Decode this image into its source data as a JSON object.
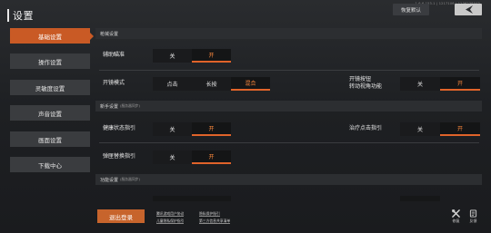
{
  "header": {
    "title": "设置",
    "version": "1.6.6.153.1 | 1217106 | 1236238043",
    "reset_label": "恢复默认"
  },
  "sidebar": {
    "items": [
      {
        "label": "基础设置",
        "active": true
      },
      {
        "label": "操作设置",
        "active": false
      },
      {
        "label": "灵敏度设置",
        "active": false
      },
      {
        "label": "声音设置",
        "active": false
      },
      {
        "label": "画面设置",
        "active": false
      },
      {
        "label": "下载中心",
        "active": false
      }
    ]
  },
  "sections": {
    "weapon": {
      "title": "枪械设置",
      "sub": ""
    },
    "novice": {
      "title": "新手设置",
      "sub": "(服务器同步)"
    },
    "function": {
      "title": "功能设置",
      "sub": "(服务器同步)"
    }
  },
  "rows": {
    "aim_assist": {
      "label": "辅助瞄准",
      "options": [
        "关",
        "开"
      ],
      "selected": 1
    },
    "scope_mode": {
      "label": "开镜模式",
      "options": [
        "点击",
        "长按",
        "混合"
      ],
      "selected": 2
    },
    "scope_button": {
      "label": "开镜按钮\n转动视角功能",
      "options": [
        "关",
        "开"
      ],
      "selected": 1
    },
    "health_guide": {
      "label": "健康状态指引",
      "options": [
        "关",
        "开"
      ],
      "selected": 1
    },
    "treatment_guide": {
      "label": "治疗点击指引",
      "options": [
        "关",
        "开"
      ],
      "selected": 1
    },
    "clip_guide": {
      "label": "弹匣替换指引",
      "options": [
        "关",
        "开"
      ],
      "selected": 1
    }
  },
  "footer": {
    "logout_label": "退出登录",
    "links": [
      "腾讯游戏用户协议",
      "隐私保护指引",
      "儿童隐私保护指引",
      "第三方信息共享清单"
    ],
    "tools": [
      {
        "icon": "repair-tool-icon",
        "label": "修复"
      },
      {
        "icon": "feedback-icon",
        "label": "反馈"
      }
    ]
  },
  "colors": {
    "accent": "#c95a25",
    "selected_text": "#ff8a3d"
  }
}
